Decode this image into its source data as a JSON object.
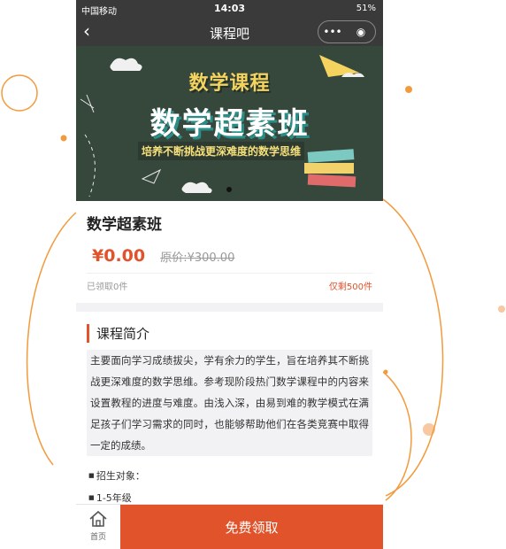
{
  "status_bar": {
    "carrier": "中国移动",
    "time": "14:03",
    "battery": "51%"
  },
  "nav": {
    "title": "课程吧",
    "capsule_more": "•••",
    "capsule_close": "◉"
  },
  "banner": {
    "title_small": "数学课程",
    "title_large": "数学超素班",
    "slogan": "培养不断挑战更深难度的数学思维"
  },
  "product": {
    "title": "数学超素班",
    "price": "¥0.00",
    "original_price": "原价:¥300.00",
    "claimed": "已领取0件",
    "remaining": "仅剩500件"
  },
  "section": {
    "title": "课程简介"
  },
  "intro_text": "主要面向学习成绩拔尖，学有余力的学生，旨在培养其不断挑战更深难度的数学思维。参考现阶段热门数学课程中的内容来设置教程的进度与难度。由浅入深，由易到难的教学模式在满足孩子们学习需求的同时，也能够帮助他们在各类竞赛中取得一定的成绩。",
  "bullets": [
    "招生对象：",
    "1-5年级"
  ],
  "bottom_bar": {
    "home_label": "首页",
    "cta_label": "免费领取"
  },
  "colors": {
    "accent": "#e0532b",
    "board": "#36473c",
    "chrome": "#3a3a3a",
    "deco": "#f39a3c"
  }
}
